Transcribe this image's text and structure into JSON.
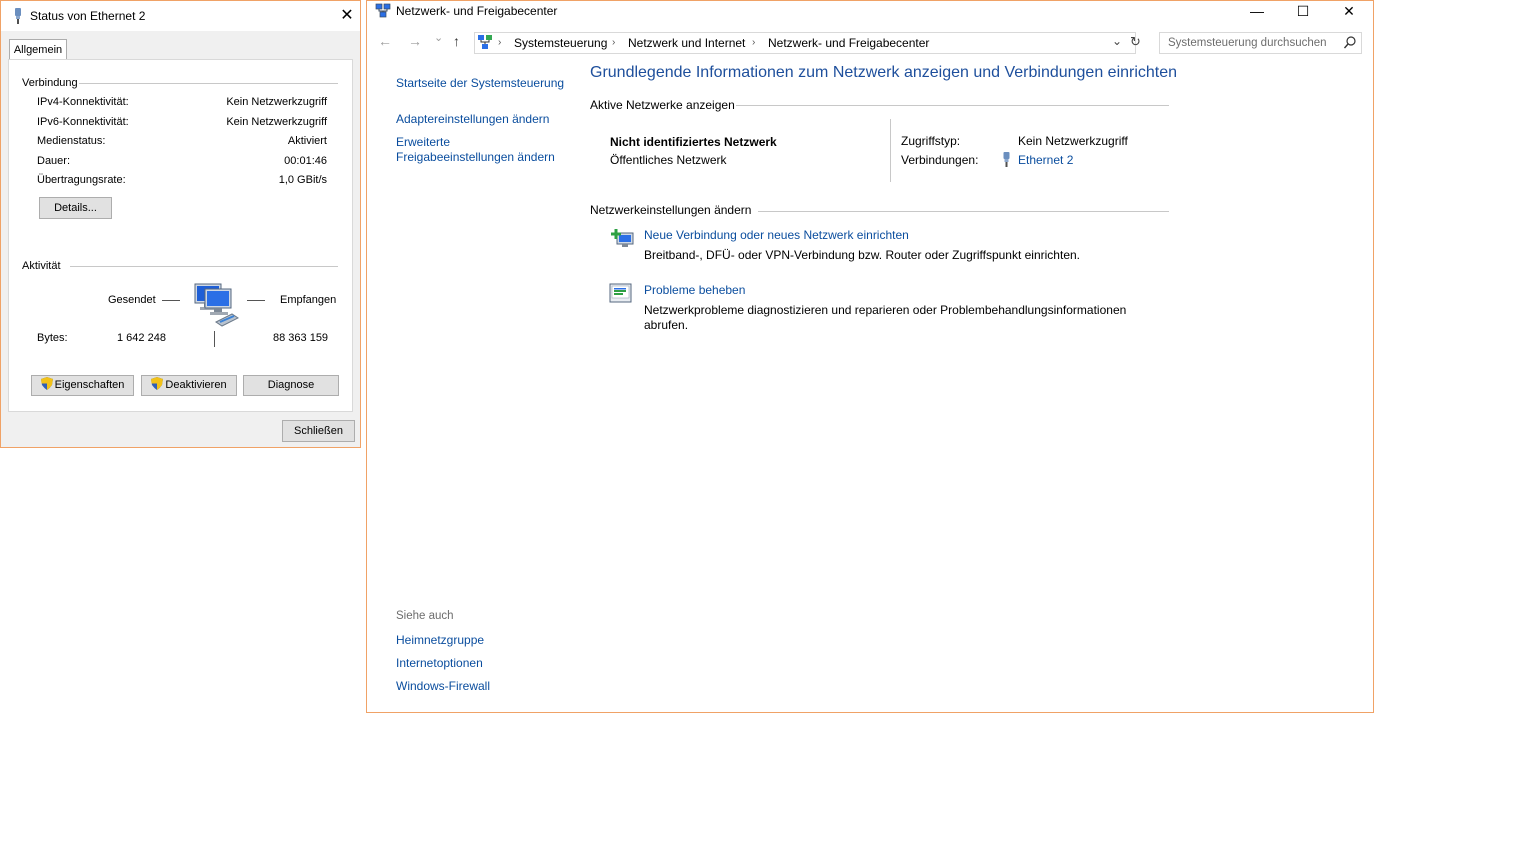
{
  "status_window": {
    "title": "Status von Ethernet 2",
    "close_glyph": "✕",
    "tab": "Allgemein",
    "connection_group": "Verbindung",
    "rows": [
      {
        "label": "IPv4-Konnektivität:",
        "value": "Kein Netzwerkzugriff"
      },
      {
        "label": "IPv6-Konnektivität:",
        "value": "Kein Netzwerkzugriff"
      },
      {
        "label": "Medienstatus:",
        "value": "Aktiviert"
      },
      {
        "label": "Dauer:",
        "value": "00:01:46"
      },
      {
        "label": "Übertragungsrate:",
        "value": "1,0 GBit/s"
      }
    ],
    "details_button": "Details...",
    "activity_group": "Aktivität",
    "sent_label": "Gesendet",
    "received_label": "Empfangen",
    "bytes_label": "Bytes:",
    "bytes_sent": "1 642 248",
    "bytes_received": "88 363 159",
    "properties_button": "Eigenschaften",
    "disable_button": "Deaktivieren",
    "diagnose_button": "Diagnose",
    "close_button": "Schließen"
  },
  "main_window": {
    "title": "Netzwerk- und Freigabecenter",
    "controls": {
      "minimize": "—",
      "maximize": "☐",
      "close": "✕"
    },
    "nav": {
      "back": "←",
      "forward": "→",
      "recent": "⌄",
      "up": "↑"
    },
    "breadcrumb": [
      "Systemsteuerung",
      "Netzwerk und Internet",
      "Netzwerk- und Freigabecenter"
    ],
    "refresh_glyph": "↻",
    "dropdown_glyph": "⌄",
    "search_placeholder": "Systemsteuerung durchsuchen",
    "sidebar": {
      "home": "Startseite der Systemsteuerung",
      "adapter": "Adaptereinstellungen ändern",
      "advanced_line1": "Erweiterte",
      "advanced_line2": "Freigabeeinstellungen ändern",
      "see_also": "Siehe auch",
      "links": [
        "Heimnetzgruppe",
        "Internetoptionen",
        "Windows-Firewall"
      ]
    },
    "heading": "Grundlegende Informationen zum Netzwerk anzeigen und Verbindungen einrichten",
    "active_networks_title": "Aktive Netzwerke anzeigen",
    "network_name": "Nicht identifiziertes Netzwerk",
    "network_type": "Öffentliches Netzwerk",
    "access_type_label": "Zugriffstyp:",
    "access_type_value": "Kein Netzwerkzugriff",
    "connections_label": "Verbindungen:",
    "connections_value": "Ethernet 2",
    "change_settings_title": "Netzwerkeinstellungen ändern",
    "task1_link": "Neue Verbindung oder neues Netzwerk einrichten",
    "task1_desc": "Breitband-, DFÜ- oder VPN-Verbindung bzw. Router oder Zugriffspunkt einrichten.",
    "task2_link": "Probleme beheben",
    "task2_desc_line1": "Netzwerkprobleme diagnostizieren und reparieren oder Problembehandlungsinformationen",
    "task2_desc_line2": "abrufen."
  }
}
